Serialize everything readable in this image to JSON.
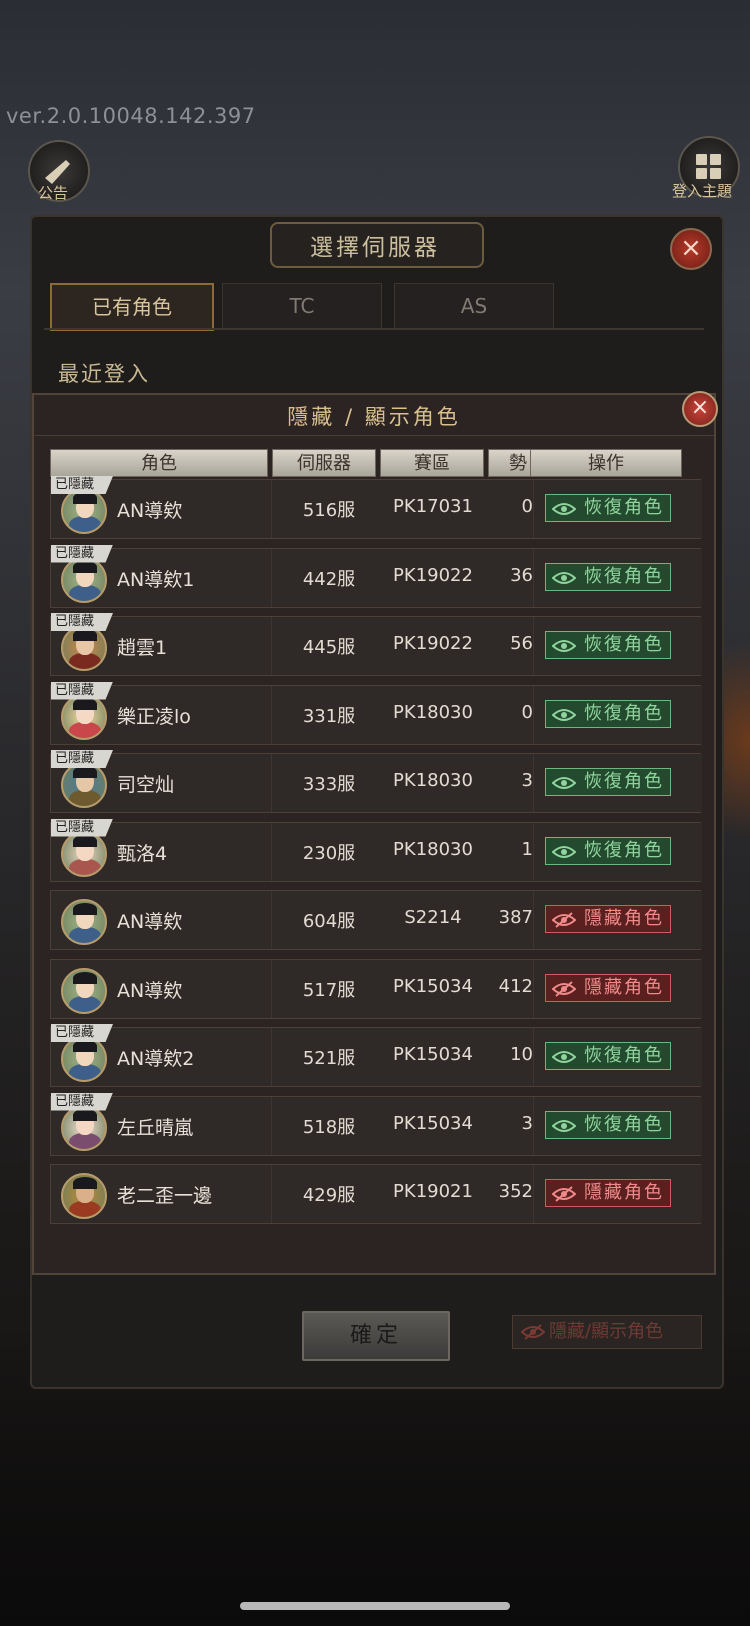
{
  "version": "ver.2.0.10048.142.397",
  "notice_label": "公告",
  "login_label": "登入主題",
  "outer": {
    "title": "選擇伺服器",
    "tabs": [
      "已有角色",
      "TC",
      "AS"
    ],
    "recent": "最近登入",
    "confirm": "確定",
    "toggle": "隱藏/顯示角色"
  },
  "modal": {
    "title": "隱藏 / 顯示角色",
    "columns": [
      "角色",
      "伺服器",
      "賽區",
      "勢力",
      "操作"
    ],
    "hidden_tag": "已隱藏",
    "rows": [
      {
        "name": "AN導欸",
        "server": "516服",
        "region": "PK17031",
        "power": "0",
        "hidden": true,
        "action": "恢復角色"
      },
      {
        "name": "AN導欸1",
        "server": "442服",
        "region": "PK19022",
        "power": "36",
        "hidden": true,
        "action": "恢復角色"
      },
      {
        "name": "趙雲1",
        "server": "445服",
        "region": "PK19022",
        "power": "56",
        "hidden": true,
        "action": "恢復角色"
      },
      {
        "name": "樂正凌lo",
        "server": "331服",
        "region": "PK18030",
        "power": "0",
        "hidden": true,
        "action": "恢復角色"
      },
      {
        "name": "司空灿",
        "server": "333服",
        "region": "PK18030",
        "power": "3",
        "hidden": true,
        "action": "恢復角色"
      },
      {
        "name": "甄洛4",
        "server": "230服",
        "region": "PK18030",
        "power": "1",
        "hidden": true,
        "action": "恢復角色"
      },
      {
        "name": "AN導欸",
        "server": "604服",
        "region": "S2214",
        "power": "387",
        "hidden": false,
        "action": "隱藏角色"
      },
      {
        "name": "AN導欸",
        "server": "517服",
        "region": "PK15034",
        "power": "412",
        "hidden": false,
        "action": "隱藏角色"
      },
      {
        "name": "AN導欸2",
        "server": "521服",
        "region": "PK15034",
        "power": "10",
        "hidden": true,
        "action": "恢復角色"
      },
      {
        "name": "左丘晴嵐",
        "server": "518服",
        "region": "PK15034",
        "power": "3",
        "hidden": true,
        "action": "恢復角色"
      },
      {
        "name": "老二歪一邊",
        "server": "429服",
        "region": "PK19021",
        "power": "352",
        "hidden": false,
        "action": "隱藏角色"
      }
    ]
  },
  "colors": {
    "restore": "#8fd49c",
    "hide": "#f08a8a",
    "gold": "#d9c08d"
  }
}
